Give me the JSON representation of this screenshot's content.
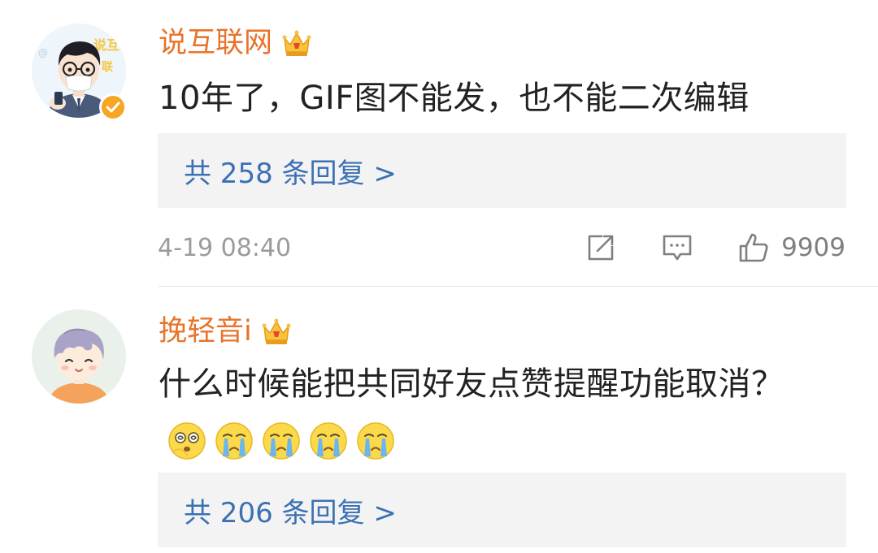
{
  "comments": [
    {
      "username": "说互联网",
      "text": "10年了，GIF图不能发，也不能二次编辑",
      "replies": "共 258 条回复 >",
      "timestamp": "4-19 08:40",
      "likes": "9909",
      "avatar": "cartoon-man-with-glasses-and-mask",
      "verified": true,
      "badge": "crown-icon"
    },
    {
      "username": "挽轻音i",
      "text": "什么时候能把共同好友点赞提醒功能取消？",
      "emojis": [
        "dizzy-face-emoji",
        "crying-face-emoji",
        "crying-face-emoji",
        "crying-face-emoji",
        "crying-face-emoji"
      ],
      "replies": "共 206 条回复 >",
      "avatar": "cartoon-boy-lavender-hair",
      "badge": "crown-icon"
    }
  ],
  "colors": {
    "username": "#e8732a",
    "link": "#3c70b4",
    "meta": "#9b9b9b",
    "reply_bg": "#f3f3f3"
  }
}
